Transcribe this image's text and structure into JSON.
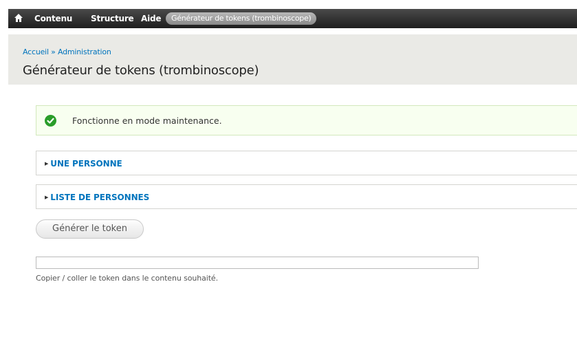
{
  "toolbar": {
    "home_icon": "home-icon",
    "items": [
      "Contenu",
      "Structure",
      "Aide"
    ],
    "active_pill": "Générateur de tokens (trombinoscope)"
  },
  "header": {
    "breadcrumb": "Accueil » Administration",
    "title": "Générateur de tokens (trombinoscope)"
  },
  "status": {
    "icon": "checkmark-circle-icon",
    "message": "Fonctionne en mode maintenance.",
    "color": "#2a9d2a"
  },
  "fieldsets": [
    {
      "label": "UNE PERSONNE"
    },
    {
      "label": "LISTE DE PERSONNES"
    }
  ],
  "form": {
    "button_label": "Générer le token",
    "token_value": "",
    "description": "Copier / coller le token dans le contenu souhaité."
  },
  "colors": {
    "link": "#0074bd",
    "header_bg": "#eaeae6",
    "toolbar_bg": "#2a2a2a"
  }
}
